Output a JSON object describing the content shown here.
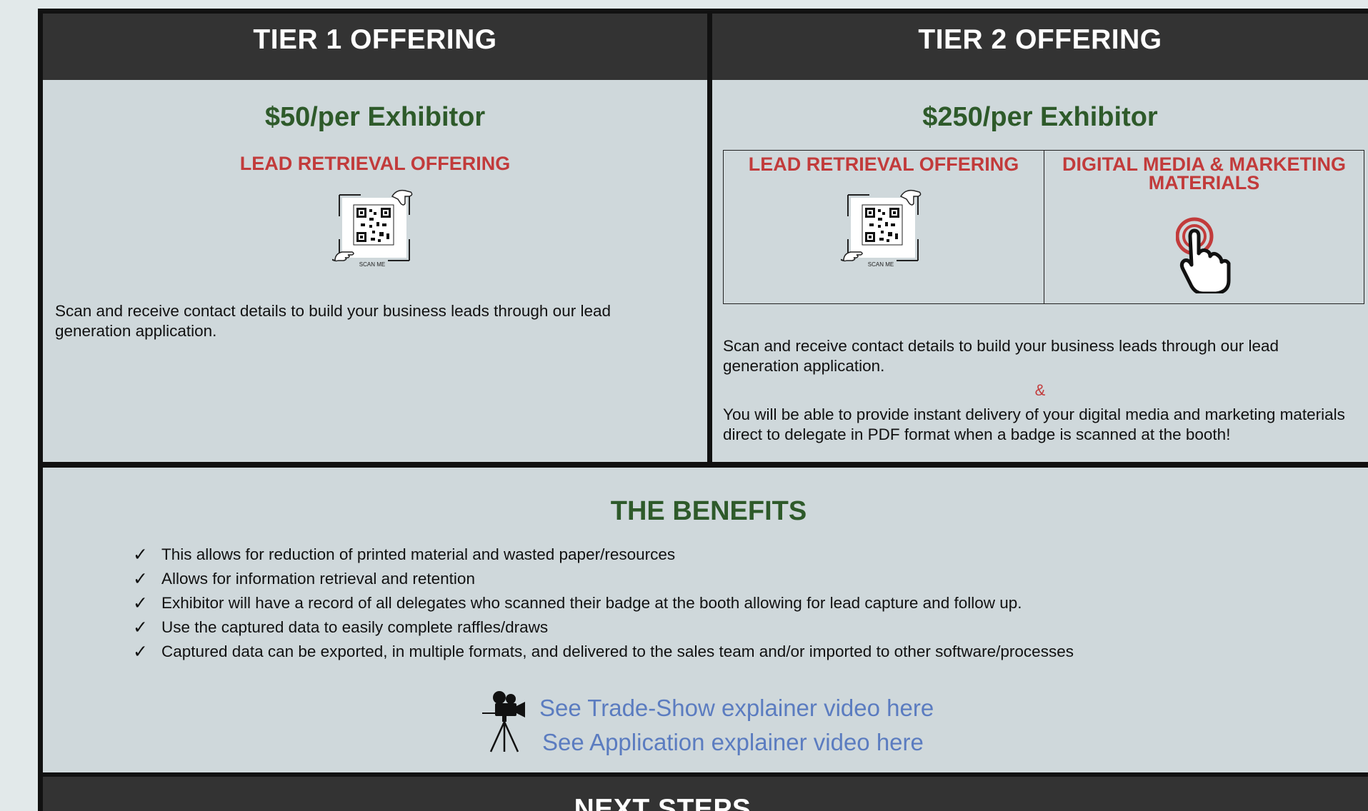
{
  "tier1": {
    "header": "TIER 1 OFFERING",
    "price": "$50/per Exhibitor",
    "offering_title": "LEAD RETRIEVAL OFFERING",
    "qr_caption": "SCAN ME",
    "description": "Scan and receive contact details to build your business leads through our lead generation application."
  },
  "tier2": {
    "header": "TIER 2 OFFERING",
    "price": "$250/per Exhibitor",
    "offering_lead_title": "LEAD RETRIEVAL OFFERING",
    "offering_digital_title": "DIGITAL MEDIA & MARKETING MATERIALS",
    "qr_caption": "SCAN ME",
    "description_1": "Scan and receive contact details to build your business leads through our lead generation application.",
    "ampersand": "&",
    "description_2": "You will be able to provide instant delivery of your digital media and marketing materials direct to delegate in PDF format when a badge is scanned at the booth!"
  },
  "benefits": {
    "title": "THE BENEFITS",
    "items": [
      "This allows for reduction of printed material and wasted paper/resources",
      "Allows for information retrieval and retention",
      "Exhibitor will have a record of all delegates who scanned their badge at the booth allowing for lead capture and follow up.",
      "Use the captured data to easily complete raffles/draws",
      "Captured data can be exported, in multiple formats, and delivered to the sales team and/or imported to other software/processes"
    ],
    "check_glyph": "✓",
    "video_links": [
      "See Trade-Show explainer video here",
      "See Application explainer video here"
    ]
  },
  "next_steps": {
    "header": "NEXT STEPS"
  },
  "colors": {
    "header_bg": "#333333",
    "panel_bg": "#cfd8db",
    "price_green": "#2e5a2a",
    "accent_red": "#c23b3b",
    "link_blue": "#5b7cc0",
    "page_bg": "#e2e9ea"
  },
  "icons": {
    "qr": "qr-code-icon",
    "pointing_hand": "pointing-hand-icon",
    "tap": "tap-hand-icon",
    "camera": "movie-camera-icon"
  }
}
